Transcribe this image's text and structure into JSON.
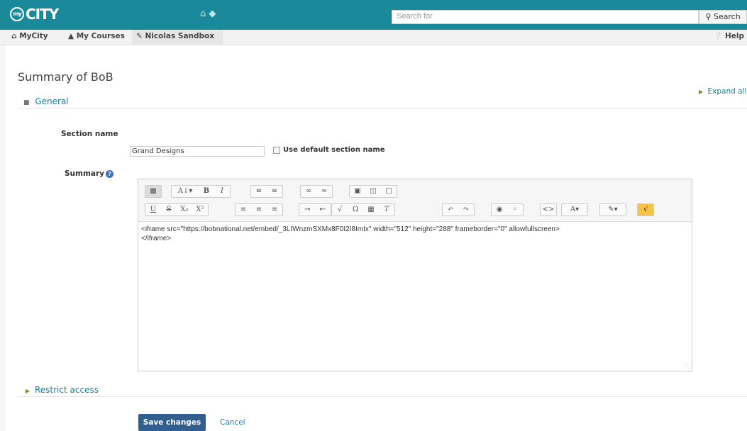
{
  "header": {
    "logo_text": "CITY",
    "logo_badge": "my",
    "icons": [
      "home-icon",
      "chat-icon"
    ],
    "search": {
      "placeholder": "Search for",
      "button_label": "Search"
    }
  },
  "nav": {
    "tabs": [
      {
        "label": "MyCity",
        "icon": "home-icon"
      },
      {
        "label": "My Courses",
        "icon": "graduation-cap-icon"
      },
      {
        "label": "Nicolas Sandbox",
        "icon": "pencil-icon",
        "active": true
      }
    ],
    "help_label": "Help"
  },
  "page": {
    "title": "Summary of BoB",
    "expand_all": "Expand all",
    "general_legend": "General",
    "section_name_label": "Section name",
    "section_name_value": "Grand Designs",
    "use_default_label": "Use default section name",
    "summary_label": "Summary",
    "editor_content": "<iframe src=\"https://bobnational.net/embed/_3LIWnzmSXMx8F0I2I8ImIx\" width=\"512\" height=\"288\" frameborder=\"0\" allowfullscreen>\n</iframe>",
    "restrict_access": "Restrict access",
    "save_label": "Save changes",
    "cancel_label": "Cancel"
  },
  "toolbar_row1": [
    "toolbar-toggle",
    "font-style",
    "bold",
    "italic",
    "unordered-list",
    "ordered-list",
    "link",
    "unlink",
    "image",
    "media",
    "manage-files"
  ],
  "toolbar_row2": [
    "underline",
    "strikethrough",
    "subscript",
    "superscript",
    "align-left",
    "align-center",
    "align-right",
    "indent",
    "outdent",
    "equation",
    "special-character",
    "table",
    "clear-formatting",
    "undo",
    "redo",
    "accessibility-checker",
    "screenreader-helper",
    "html-toggle",
    "font-color",
    "highlight",
    "wiris"
  ],
  "colors": {
    "header_bg": "#1a8a9a",
    "link": "#1a7fa0",
    "primary_button": "#2f5e8f"
  }
}
